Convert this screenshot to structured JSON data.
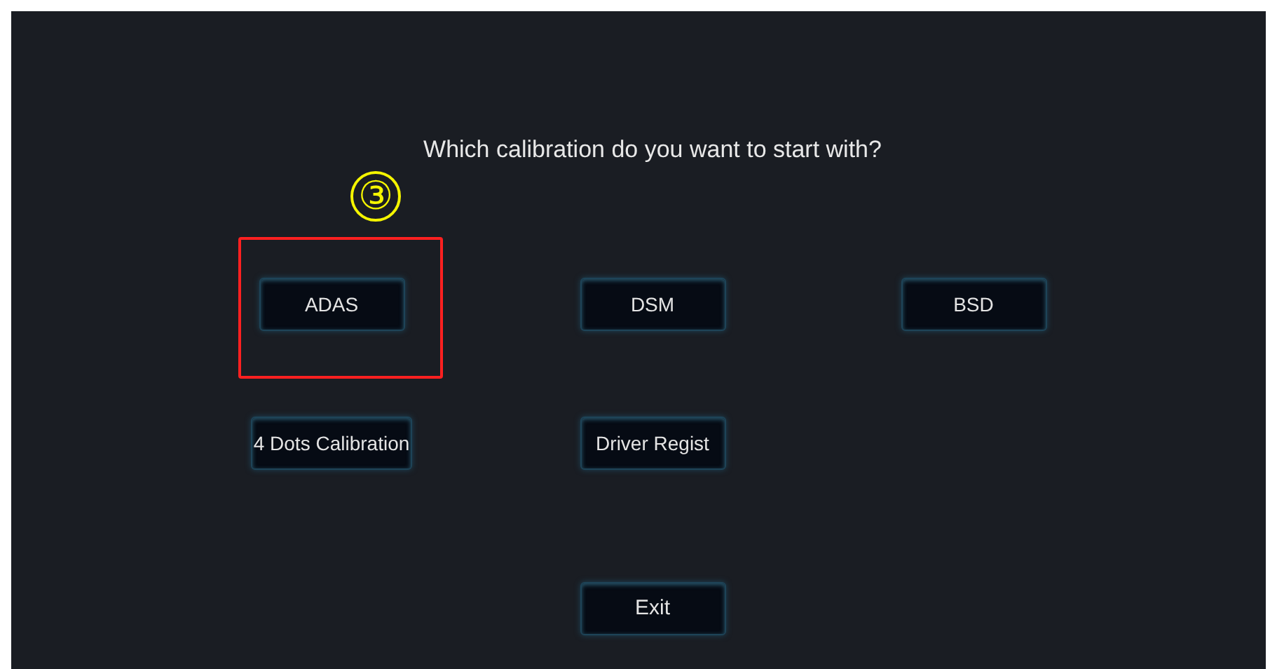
{
  "prompt": "Which calibration do you want to start with?",
  "annotation": {
    "marker": "③"
  },
  "options": [
    {
      "label": "ADAS",
      "highlighted": true
    },
    {
      "label": "DSM",
      "highlighted": false
    },
    {
      "label": "BSD",
      "highlighted": false
    },
    {
      "label": "4 Dots Calibration",
      "highlighted": false
    },
    {
      "label": "Driver Regist",
      "highlighted": false
    }
  ],
  "exit_button": {
    "label": "Exit"
  }
}
